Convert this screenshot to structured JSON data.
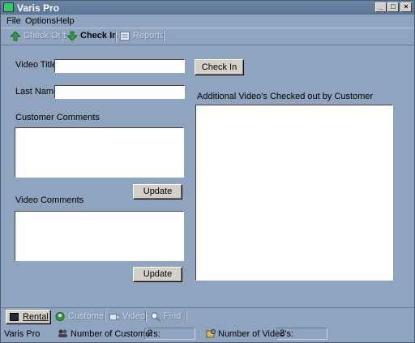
{
  "window": {
    "title": "Varis  Pro"
  },
  "menu": [
    "File",
    "Options",
    "Help"
  ],
  "toolbar": [
    {
      "label": "Check Out",
      "state": "disabled"
    },
    {
      "label": "Check In",
      "state": "active"
    },
    {
      "label": "Reports",
      "state": "disabled"
    }
  ],
  "form": {
    "video_title_label": "Video Title",
    "video_title_value": "",
    "last_name_label": "Last Name",
    "last_name_value": "",
    "check_in_button": "Check In",
    "customer_comments_label": "Customer Comments",
    "customer_comments_value": "",
    "update_button_1": "Update",
    "video_comments_label": "Video Comments",
    "video_comments_value": "",
    "update_button_2": "Update",
    "additional_videos_label": "Additional Video's Checked out by Customer"
  },
  "bottom_tabs": [
    {
      "label": "Rental",
      "state": "active"
    },
    {
      "label": "Customer",
      "state": "disabled"
    },
    {
      "label": "Video",
      "state": "disabled"
    },
    {
      "label": "Find",
      "state": "disabled"
    }
  ],
  "status": {
    "app": "Varis Pro",
    "customers_label": "Number of Customers:",
    "customers_value": "2",
    "videos_label": "Number of Video's:",
    "videos_value": "2"
  },
  "colors": {
    "background": "#8fa4bf",
    "titlebar": "#5b7394"
  }
}
